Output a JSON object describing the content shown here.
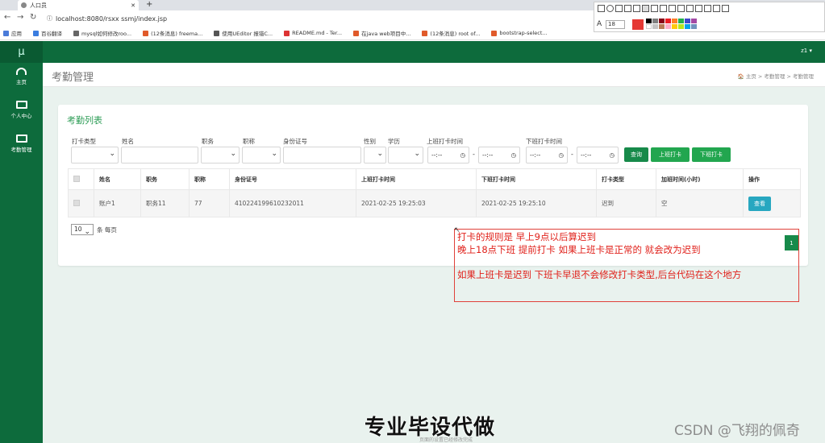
{
  "browser": {
    "tab_title": "人口员",
    "url": "localhost:8080/rsxx ssmj/index.jsp",
    "bookmarks": [
      "应用",
      "百谷翻译",
      "mysql如何修改roo...",
      "(12条消息) freema...",
      "使用UEditor 报错C...",
      "README.md - Ter...",
      "在java web项目中...",
      "(12条消息) root of...",
      "bootstrap-select..."
    ]
  },
  "annotation_toolbar": {
    "font_label": "A",
    "font_size": "18"
  },
  "app": {
    "logo": "μ",
    "user": "z1 ▾",
    "sidebar": [
      {
        "label": "主页",
        "icon": "dashboard-icon"
      },
      {
        "label": "个人中心",
        "icon": "monitor-icon"
      },
      {
        "label": "考勤管理",
        "icon": "monitor-icon"
      }
    ],
    "page_title": "考勤管理",
    "breadcrumb": "🏠 主页  >  考勤管理  >  考勤管理"
  },
  "panel": {
    "title": "考勤列表",
    "filters": {
      "type_label": "打卡类型",
      "name_label": "姓名",
      "position_label": "职务",
      "title_label": "职称",
      "id_label": "身份证号",
      "gender_label": "性别",
      "edu_label": "学历",
      "checkin_label": "上班打卡时间",
      "checkout_label": "下班打卡时间",
      "time_placeholder": "--:--",
      "dash": "-"
    },
    "buttons": {
      "query": "查询",
      "checkin": "上班打卡",
      "checkout": "下班打卡"
    },
    "table": {
      "headers": [
        "姓名",
        "职务",
        "职称",
        "身份证号",
        "上班打卡时间",
        "下班打卡时间",
        "打卡类型",
        "加班时间(小时)",
        "操作"
      ],
      "rows": [
        [
          "账户1",
          "职务11",
          "77",
          "410224199610232011",
          "2021-02-25 19:25:03",
          "2021-02-25 19:25:10",
          "迟到",
          "空",
          "查看"
        ]
      ]
    },
    "pagination": {
      "page_size": "10",
      "unit": "条 每页",
      "current_page": "1"
    }
  },
  "note": {
    "line1": "打卡的规则是  早上9点以后算迟到",
    "line2": "晚上18点下班  提前打卡  如果上班卡是正常的 就会改为迟到",
    "line3": "如果上班卡是迟到 下班卡早退不会修改打卡类型,后台代码在这个地方"
  },
  "overlay": {
    "caption": "专业毕设代做",
    "watermark": "CSDN @飞翔的佩奇",
    "footer": "页面的设置已经修改完成"
  },
  "colors": {
    "sidebar": "#0d6b3c",
    "accent_green": "#178a4a",
    "view_button": "#27a7c0",
    "note_red": "#e0201a"
  }
}
